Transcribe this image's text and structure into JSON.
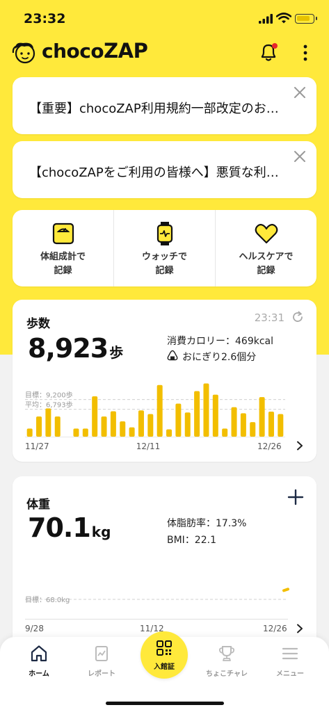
{
  "status_bar": {
    "time": "23:32"
  },
  "header": {
    "logo_text_choco": "choco",
    "logo_text_zap": "ZAP",
    "bell_has_badge": true
  },
  "notices": [
    {
      "text": "【重要】chocoZAP利用規約一部改定のお…"
    },
    {
      "text": "【chocoZAPをご利用の皆様へ】悪質な利…"
    }
  ],
  "record_buttons": [
    {
      "label": "体組成計で\n記録",
      "icon": "scale-icon"
    },
    {
      "label": "ウォッチで\n記録",
      "icon": "watch-icon"
    },
    {
      "label": "ヘルスケアで\n記録",
      "icon": "heart-icon"
    }
  ],
  "steps": {
    "title": "歩数",
    "time": "23:31",
    "value": "8,923",
    "unit": "歩",
    "calories": "消費カロリー：469kcal",
    "onigiri": "おにぎり2.6個分"
  },
  "weight": {
    "title": "体重",
    "value": "70.1",
    "unit": "kg",
    "body_fat": "体脂肪率：17.3%",
    "bmi": "BMI：22.1"
  },
  "chart_data": [
    {
      "type": "bar",
      "title": "歩数",
      "goal_label": "目標：9,200歩",
      "avg_label": "平均：6,793歩",
      "goal": 9200,
      "average": 6793,
      "x_tick_labels": [
        "11/27",
        "12/11",
        "12/26"
      ],
      "ylim": [
        0,
        15000
      ],
      "values": [
        2000,
        5000,
        7000,
        5000,
        0,
        2000,
        2000,
        10000,
        5000,
        6300,
        3800,
        2300,
        6500,
        5600,
        12800,
        1800,
        8200,
        6000,
        11300,
        13200,
        10400,
        2000,
        7300,
        5800,
        3600,
        9800,
        6200,
        5600
      ],
      "color": "#f2be00"
    },
    {
      "type": "line",
      "title": "体重",
      "goal_label": "目標：68.0kg",
      "goal": 68.0,
      "x_tick_labels": [
        "9/28",
        "11/12",
        "12/26"
      ],
      "ylim": [
        64,
        74
      ],
      "points": [
        {
          "x": "12/25",
          "y": 69.8
        },
        {
          "x": "12/26",
          "y": 70.1
        }
      ],
      "color": "#f2be00"
    }
  ],
  "tabbar": {
    "tabs": [
      {
        "label": "ホーム",
        "active": true
      },
      {
        "label": "レポート",
        "active": false
      },
      {
        "label": "入館証",
        "active": false
      },
      {
        "label": "ちょこチャレ",
        "active": false
      },
      {
        "label": "メニュー",
        "active": false
      }
    ]
  },
  "colors": {
    "brand_yellow": "#ffe93b",
    "bar_yellow": "#f2be00",
    "badge_red": "#e8262b"
  }
}
